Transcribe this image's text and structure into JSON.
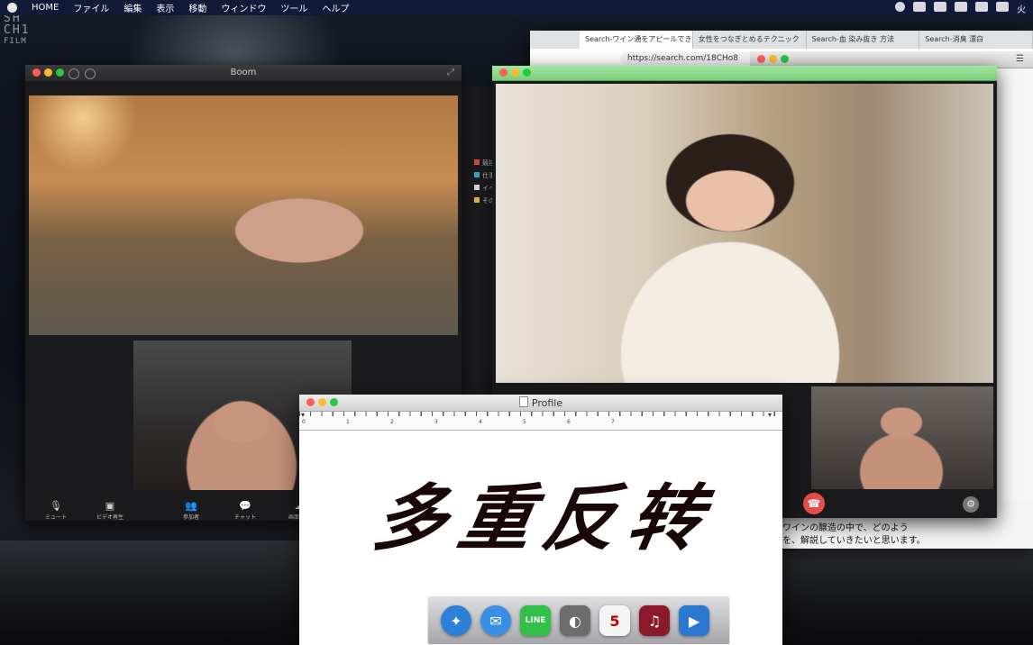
{
  "menubar": {
    "home_label": "HOME",
    "items": [
      "ファイル",
      "編集",
      "表示",
      "移動",
      "ウィンドウ",
      "ツール",
      "ヘルプ"
    ],
    "clock_day": "火"
  },
  "watermark": {
    "line1": "SH",
    "line2": "CH1",
    "line3": "FILM"
  },
  "boom": {
    "title": "Boom",
    "controls": [
      {
        "icon": "microphone-icon",
        "label": "ミュート"
      },
      {
        "icon": "video-camera-icon",
        "label": "ビデオ再生"
      },
      {
        "icon": "participants-icon",
        "label": "参加者"
      },
      {
        "icon": "chat-bubble-icon",
        "label": "チャット"
      },
      {
        "icon": "cloud-upload-icon",
        "label": "画面共有"
      }
    ]
  },
  "browser": {
    "tabs": [
      "Search-ワイン通をアピールでき…",
      "女性をつなぎとめるテクニック",
      "Search-血 染み抜き 方法",
      "Search-消臭 漂白"
    ],
    "address": "https://search.com/18CHo8",
    "article_lines": [
      "、ワインの醸造の中で、どのよう",
      "かを、解説していきたいと思います。"
    ]
  },
  "back_window": {
    "legend": [
      "競技",
      "仕事",
      "イベ",
      "その"
    ]
  },
  "profile": {
    "title": "Profile",
    "ruler_numbers": [
      "0",
      "1",
      "2",
      "3",
      "4",
      "5",
      "6",
      "7"
    ],
    "headline": "多重反转"
  },
  "dock": {
    "items": [
      {
        "icon": "safari-compass-icon",
        "glyph": "✦",
        "color": "#2e7fd8"
      },
      {
        "icon": "mail-envelope-icon",
        "glyph": "✉",
        "color": "#3a8ee6"
      },
      {
        "icon": "line-app-icon",
        "glyph": "LINE",
        "color": "#32c046"
      },
      {
        "icon": "boom-app-icon",
        "glyph": "◐",
        "color": "#6c6c6c"
      },
      {
        "icon": "calendar-icon",
        "glyph": "5",
        "color": "#f4f4f4"
      },
      {
        "icon": "music-note-icon",
        "glyph": "♫",
        "color": "#8a1a2a"
      },
      {
        "icon": "video-camera-app-icon",
        "glyph": "▶",
        "color": "#2a78d0"
      }
    ]
  },
  "colors": {
    "menubar": "#121a3a",
    "chat_titlebar": "#8ed68e",
    "end_call": "#e74c4c",
    "headline": "#1a0707"
  }
}
